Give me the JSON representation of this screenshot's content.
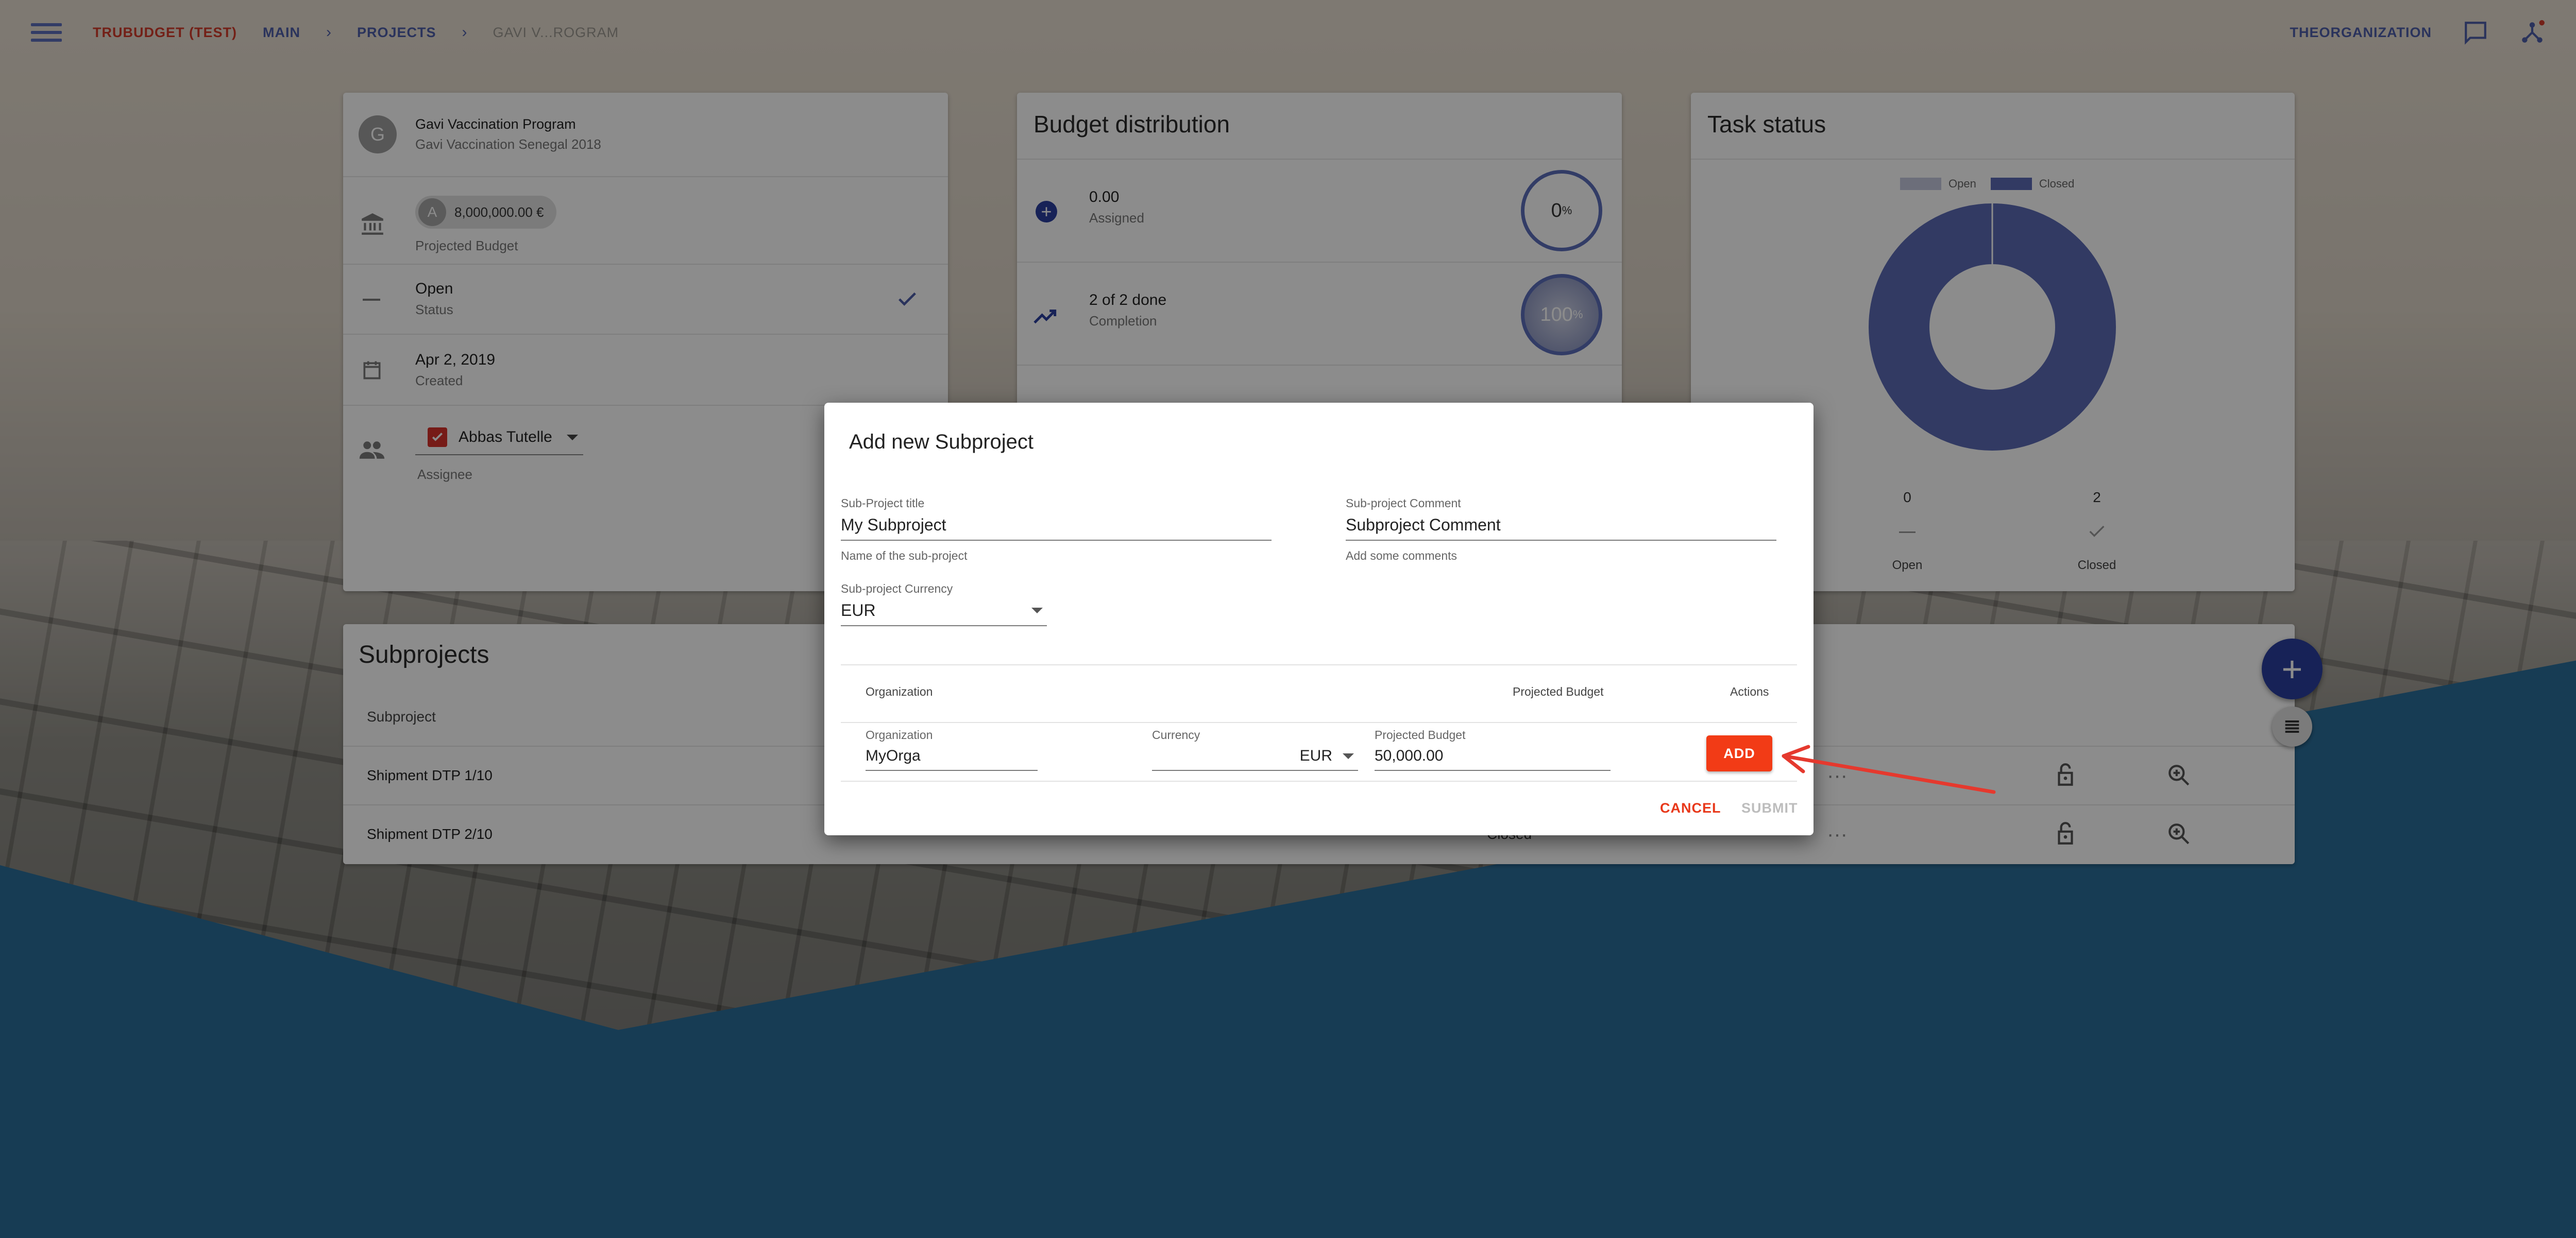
{
  "app": {
    "brand": "TRUBUDGET (TEST)",
    "breadcrumbs": [
      "MAIN",
      "PROJECTS",
      "GAVI V...ROGRAM"
    ],
    "organization": "THEORGANIZATION"
  },
  "project_card": {
    "avatar_letter": "G",
    "title": "Gavi Vaccination Program",
    "subtitle": "Gavi Vaccination Senegal 2018",
    "budget_chip_letter": "A",
    "budget_amount": "8,000,000.00 €",
    "budget_label": "Projected Budget",
    "status_value": "Open",
    "status_label": "Status",
    "created_value": "Apr 2, 2019",
    "created_label": "Created",
    "assignee_value": "Abbas Tutelle",
    "assignee_label": "Assignee"
  },
  "budget_card": {
    "title": "Budget distribution",
    "assigned_value": "0.00",
    "assigned_label": "Assigned",
    "assigned_ring": "0",
    "completion_value": "2 of 2 done",
    "completion_label": "Completion",
    "completion_ring": "100"
  },
  "task_card": {
    "title": "Task status",
    "legend_open": "Open",
    "legend_closed": "Closed",
    "open_count": "0",
    "closed_count": "2",
    "open_label": "Open",
    "closed_label": "Closed",
    "colors": {
      "open": "#c5c8de",
      "closed": "#5b6bb5"
    }
  },
  "chart_data": {
    "type": "pie",
    "categories": [
      "Open",
      "Closed"
    ],
    "values": [
      0,
      2
    ],
    "title": "",
    "legend": "top"
  },
  "subprojects": {
    "title": "Subprojects",
    "column_subproject": "Subproject",
    "rows": [
      {
        "name": "Shipment DTP 1/10",
        "status": ""
      },
      {
        "name": "Shipment DTP 2/10",
        "status": "Closed"
      }
    ]
  },
  "dialog": {
    "title": "Add new Subproject",
    "title_label": "Sub-Project title",
    "title_value": "My Subproject",
    "title_help": "Name of the sub-project",
    "comment_label": "Sub-project Comment",
    "comment_value": "Subproject Comment",
    "comment_help": "Add some comments",
    "currency_label": "Sub-project Currency",
    "currency_value": "EUR",
    "table_header_org": "Organization",
    "table_header_budget": "Projected Budget",
    "table_header_actions": "Actions",
    "row_org_label": "Organization",
    "row_org_value": "MyOrga",
    "row_currency_label": "Currency",
    "row_currency_value": "EUR",
    "row_budget_label": "Projected Budget",
    "row_budget_value": "50,000.00",
    "add_label": "ADD",
    "cancel_label": "CANCEL",
    "submit_label": "SUBMIT"
  },
  "colors": {
    "accent": "#4d5da8",
    "brand": "#d23b2a",
    "add_button": "#f23b16",
    "fab": "#2b3f9e"
  }
}
